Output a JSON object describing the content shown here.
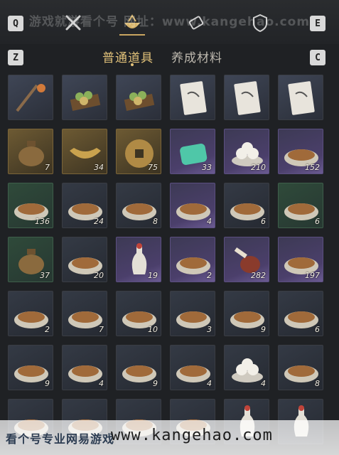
{
  "top_bar": {
    "left_key": "Q",
    "right_key": "E",
    "icons": [
      "crossed-tools-icon",
      "bowl-cargo-icon",
      "scroll-icon",
      "shield-badge-icon"
    ],
    "watermark": "游戏就游看个号 网址：www.kangehao.com"
  },
  "sub_tabs": {
    "left_key": "Z",
    "right_key": "C",
    "tabs": [
      {
        "label": "普通道具",
        "active": true
      },
      {
        "label": "养成材料",
        "active": false
      }
    ]
  },
  "grid": {
    "rows": [
      [
        {
          "icon": "pickaxe-lantern-icon",
          "frame": "plain",
          "qty": ""
        },
        {
          "icon": "green-buns-tray-icon",
          "frame": "plain",
          "qty": ""
        },
        {
          "icon": "pastry-tray-icon",
          "frame": "plain",
          "qty": ""
        },
        {
          "icon": "horse-card-icon",
          "frame": "plain",
          "qty": ""
        },
        {
          "icon": "horse-card-icon",
          "frame": "plain",
          "qty": ""
        },
        {
          "icon": "horse-card-icon",
          "frame": "plain",
          "qty": ""
        }
      ],
      [
        {
          "icon": "bronze-pot-icon",
          "frame": "gold",
          "qty": "7"
        },
        {
          "icon": "gold-ingot-icon",
          "frame": "gold",
          "qty": "34"
        },
        {
          "icon": "coin-icon",
          "frame": "gold",
          "qty": "75"
        },
        {
          "icon": "jade-stone-icon",
          "frame": "purple",
          "qty": "33"
        },
        {
          "icon": "rice-balls-icon",
          "frame": "purple",
          "qty": "210"
        },
        {
          "icon": "porridge-bowl-icon",
          "frame": "purple",
          "qty": "152"
        }
      ],
      [
        {
          "icon": "egg-soup-bowl-icon",
          "frame": "green",
          "qty": "136"
        },
        {
          "icon": "stew-dish-icon",
          "frame": "dark",
          "qty": "24"
        },
        {
          "icon": "grilled-fish-icon",
          "frame": "dark",
          "qty": "8"
        },
        {
          "icon": "fried-egg-plate-icon",
          "frame": "purple",
          "qty": "4"
        },
        {
          "icon": "okra-plate-icon",
          "frame": "dark",
          "qty": "6"
        },
        {
          "icon": "mixed-stew-icon",
          "frame": "green",
          "qty": "6"
        }
      ],
      [
        {
          "icon": "clay-pot-stew-icon",
          "frame": "green",
          "qty": "37"
        },
        {
          "icon": "braised-bowl-icon",
          "frame": "dark",
          "qty": "20"
        },
        {
          "icon": "white-vase-icon",
          "frame": "purple",
          "qty": "19"
        },
        {
          "icon": "fried-pastry-icon",
          "frame": "purple",
          "qty": "2"
        },
        {
          "icon": "roast-leg-icon",
          "frame": "purple",
          "qty": "282"
        },
        {
          "icon": "dumpling-basket-icon",
          "frame": "purple",
          "qty": "197"
        }
      ],
      [
        {
          "icon": "fried-rolls-plate-icon",
          "frame": "dark",
          "qty": "2"
        },
        {
          "icon": "sliced-meat-plate-icon",
          "frame": "dark",
          "qty": "7"
        },
        {
          "icon": "dessert-plate-icon",
          "frame": "dark",
          "qty": "10"
        },
        {
          "icon": "rice-cake-icon",
          "frame": "dark",
          "qty": "3"
        },
        {
          "icon": "toast-slices-icon",
          "frame": "dark",
          "qty": "9"
        },
        {
          "icon": "pancake-stack-icon",
          "frame": "dark",
          "qty": "6"
        }
      ],
      [
        {
          "icon": "steamed-bun-icon",
          "frame": "dark",
          "qty": "9"
        },
        {
          "icon": "noodle-bowl-icon",
          "frame": "dark",
          "qty": "4"
        },
        {
          "icon": "noodle-bowl-icon",
          "frame": "dark",
          "qty": "9"
        },
        {
          "icon": "fried-noodles-icon",
          "frame": "dark",
          "qty": "4"
        },
        {
          "icon": "tangyuan-bowl-icon",
          "frame": "dark",
          "qty": "4"
        },
        {
          "icon": "noodle-soup-icon",
          "frame": "dark",
          "qty": "8"
        }
      ],
      [
        {
          "icon": "soup-bowl-icon",
          "frame": "dark",
          "qty": ""
        },
        {
          "icon": "soup-bowl-icon",
          "frame": "dark",
          "qty": ""
        },
        {
          "icon": "soup-bowl-icon",
          "frame": "dark",
          "qty": ""
        },
        {
          "icon": "soup-bowl-icon",
          "frame": "dark",
          "qty": ""
        },
        {
          "icon": "red-bottle-icon",
          "frame": "dark",
          "qty": ""
        },
        {
          "icon": "red-bottle-icon",
          "frame": "dark",
          "qty": ""
        }
      ]
    ]
  },
  "bottom_watermark": {
    "text_cn": "看个号专业网易游戏",
    "url": "www.kangehao.com"
  }
}
